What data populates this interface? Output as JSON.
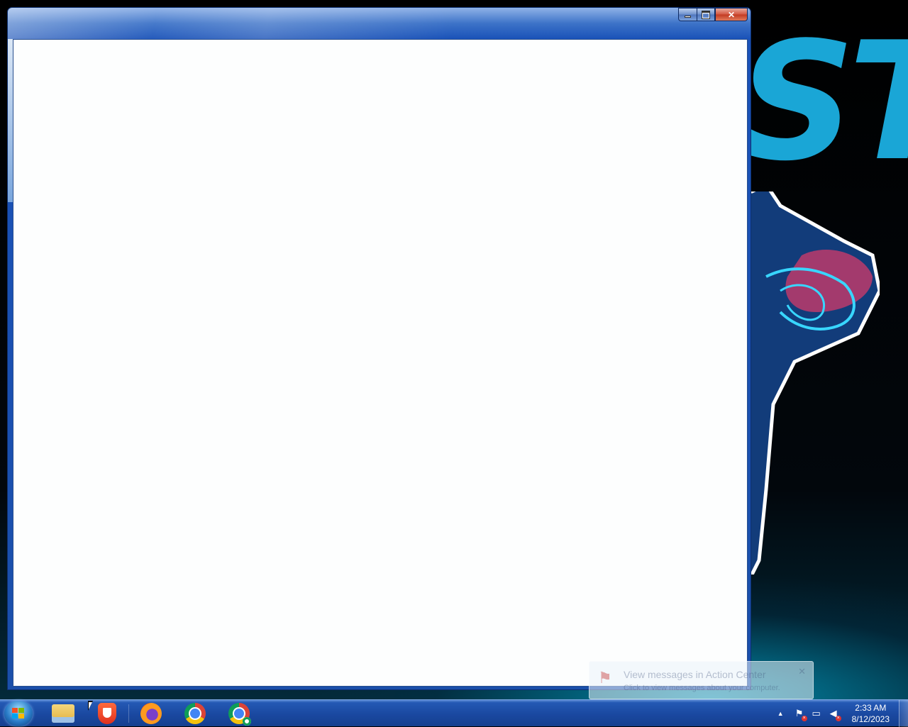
{
  "desktop": {
    "wallpaper_text": "ST"
  },
  "window": {
    "title": "",
    "buttons": {
      "minimize_icon": "minimize-icon",
      "maximize_icon": "maximize-icon",
      "close_icon": "close-icon",
      "close_glyph": "✕"
    }
  },
  "notification": {
    "title": "View messages in Action Center",
    "body": "Click to view messages about your computer.",
    "close_glyph": "✕"
  },
  "taskbar": {
    "pinned": [
      {
        "name": "Windows Explorer",
        "icon": "folder-icon"
      },
      {
        "name": "Brave",
        "icon": "brave-icon"
      },
      {
        "name": "Firefox",
        "icon": "firefox-icon"
      },
      {
        "name": "Google Chrome",
        "icon": "chrome-icon"
      },
      {
        "name": "Chrome Remote Desktop",
        "icon": "chrome-app-icon"
      }
    ],
    "tray": {
      "show_hidden_glyph": "▲",
      "action_center_icon": "flag-icon",
      "network_icon": "network-icon",
      "volume_icon": "speaker-muted-icon"
    },
    "clock": {
      "time": "2:33 AM",
      "date": "8/12/2023"
    }
  },
  "colors": {
    "window_frame": "#1a52b8",
    "client_bg": "#fdfefe",
    "taskbar": "#1a48a0",
    "wallpaper_accent": "#1aa6d6"
  }
}
